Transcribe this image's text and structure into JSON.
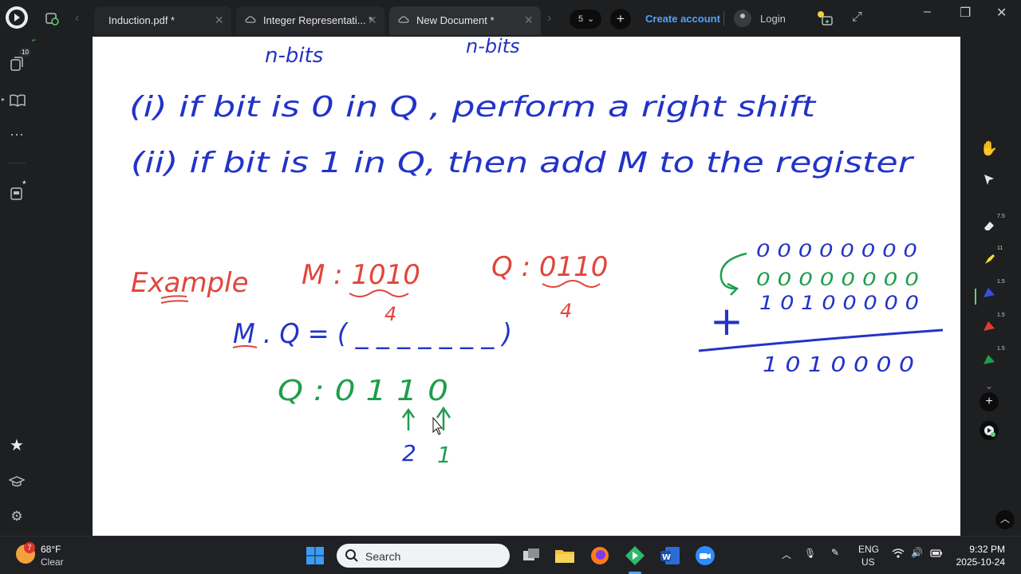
{
  "tabs": [
    {
      "label": "Induction.pdf *",
      "active": false
    },
    {
      "label": "Integer Representati... *",
      "active": false
    },
    {
      "label": "New Document *",
      "active": true
    }
  ],
  "page_count": "5",
  "create_account": "Create account",
  "login": "Login",
  "rail": {
    "pages_badge": "10",
    "notes_badge": "*"
  },
  "toolbar": {
    "eraser_size": "7.5",
    "highlighter_size": "11",
    "blue_pen_size": "1.5",
    "red_pen_size": "1.5",
    "green_pen_size": "1.5"
  },
  "board": {
    "top_left": "n-bits",
    "top_mid": "n-bits",
    "rule1": "(i)  if  bit  is  0  in  Q , perform  a  right shift",
    "rule2": "(ii)  if  bit  is  1  in  Q,  then  add  M  to  the  register",
    "example": "Example",
    "m_value": "M : 1010",
    "m_bits": "4",
    "q_value": "Q : 0110",
    "q_bits": "4",
    "mq": "M . Q  =  ( _ _ _ _ _ _ _ )",
    "q_row": "Q :  0 1 1 0",
    "step2": "2",
    "step1": "1",
    "row1": "0 0 0 0 0 0 0 0",
    "row2": "0 0 0 0 0 0 0 0",
    "row3": "1 0 1 0 0 0 0 0",
    "plus": "+",
    "result": "1 0 1 0 0 0 0"
  },
  "taskbar": {
    "weather_badge": "7",
    "temperature": "68°F",
    "condition": "Clear",
    "search_placeholder": "Search",
    "lang": "ENG",
    "region": "US",
    "time": "9:32 PM",
    "date": "2025-10-24"
  },
  "colors": {
    "ink_blue": "#2233c8",
    "ink_red": "#e0463c",
    "ink_green": "#1f9e4b",
    "link": "#4fa3ff"
  }
}
